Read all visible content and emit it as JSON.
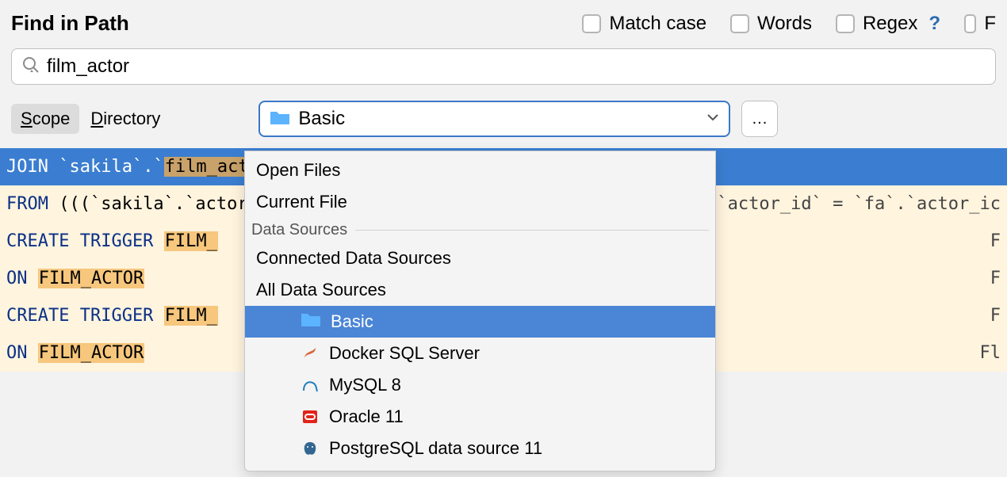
{
  "title": "Find in Path",
  "options": {
    "match_case": "Match case",
    "words": "Words",
    "regex": "Regex",
    "fourth": "F"
  },
  "search": {
    "value": "film_actor"
  },
  "scope": {
    "scope_label": "Scope",
    "directory_label": "Directory",
    "dropdown_value": "Basic",
    "more": "..."
  },
  "results": [
    {
      "pre_kw": "JOIN",
      "mid1": " `sakila`.`",
      "hl": "film_acto",
      "mid2": "",
      "trail": ""
    },
    {
      "pre_kw": "FROM",
      "mid1": " (((`sakila`.`actor",
      "hl": "",
      "mid2": "",
      "trail": "a`.`actor_id` = `fa`.`actor_ic"
    },
    {
      "pre_kw": "CREATE TRIGGER",
      "mid1": " ",
      "hl": "FILM_",
      "mid2": "",
      "trail": "F"
    },
    {
      "pre_kw": "ON",
      "mid1": " ",
      "hl": "FILM_ACTOR",
      "mid2": "",
      "trail": "F"
    },
    {
      "pre_kw": "CREATE TRIGGER",
      "mid1": " ",
      "hl": "FILM_",
      "mid2": "",
      "trail": "F"
    },
    {
      "pre_kw": "ON",
      "mid1": " ",
      "hl": "FILM_ACTOR",
      "mid2": "",
      "trail": "Fl"
    }
  ],
  "popup": {
    "open_files": "Open Files",
    "current_file": "Current File",
    "section_ds": "Data Sources",
    "connected": "Connected Data Sources",
    "all_ds": "All Data Sources",
    "items": {
      "basic": "Basic",
      "docker": "Docker SQL Server",
      "mysql": "MySQL 8",
      "oracle": "Oracle 11",
      "postgres": "PostgreSQL data source 11"
    }
  },
  "help_char": "?"
}
